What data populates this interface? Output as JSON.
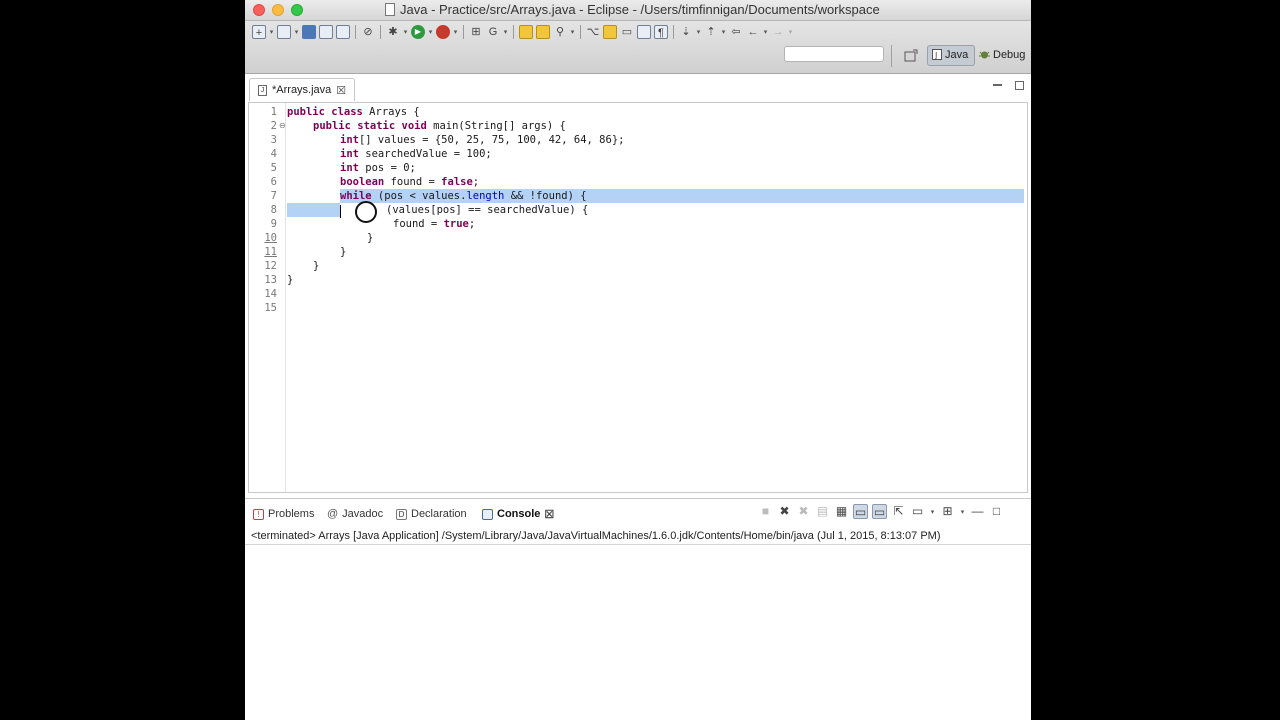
{
  "window": {
    "title": "Java - Practice/src/Arrays.java - Eclipse - /Users/timfinnigan/Documents/workspace"
  },
  "toolbar": {
    "perspectives": [
      {
        "label": "Java",
        "active": true
      },
      {
        "label": "Debug",
        "active": false
      }
    ]
  },
  "editor": {
    "tab_label": "*Arrays.java",
    "line_numbers": [
      "1",
      "2",
      "3",
      "4",
      "5",
      "6",
      "7",
      "8",
      "9",
      "10",
      "11",
      "12",
      "13",
      "14",
      "15"
    ],
    "code": {
      "l1_kw": "public class",
      "l1_rest": " Arrays {",
      "l2_kw": "public static void",
      "l2_rest": " main(String[] args) {",
      "l3_kw": "int",
      "l3_rest": "[] values = {50, 25, 75, 100, 42, 64, 86};",
      "l4_kw": "int",
      "l4_rest": " searchedValue = 100;",
      "l5_kw": "int",
      "l5_rest": " pos = 0;",
      "l6_kw": "boolean",
      "l6_mid": " found = ",
      "l6_kw2": "false",
      "l6_end": ";",
      "l7_kw": "while",
      "l7_a": " (pos < values.",
      "l7_fld": "length",
      "l7_b": " && !found) {",
      "l8_rest": "(values[pos] == searchedValue) {",
      "l9_a": "found = ",
      "l9_kw": "true",
      "l9_end": ";",
      "l10": "}",
      "l11": "}",
      "l12": "}",
      "l13": "}"
    }
  },
  "bottom_panel": {
    "tabs": [
      {
        "label": "Problems"
      },
      {
        "label": "Javadoc"
      },
      {
        "label": "Declaration"
      },
      {
        "label": "Console",
        "active": true
      }
    ],
    "console_status": "<terminated> Arrays [Java Application] /System/Library/Java/JavaVirtualMachines/1.6.0.jdk/Contents/Home/bin/java (Jul 1, 2015, 8:13:07 PM)"
  },
  "colors": {
    "keyword": "#7f0055",
    "field": "#0000c0",
    "selection": "#b3d2f5"
  }
}
